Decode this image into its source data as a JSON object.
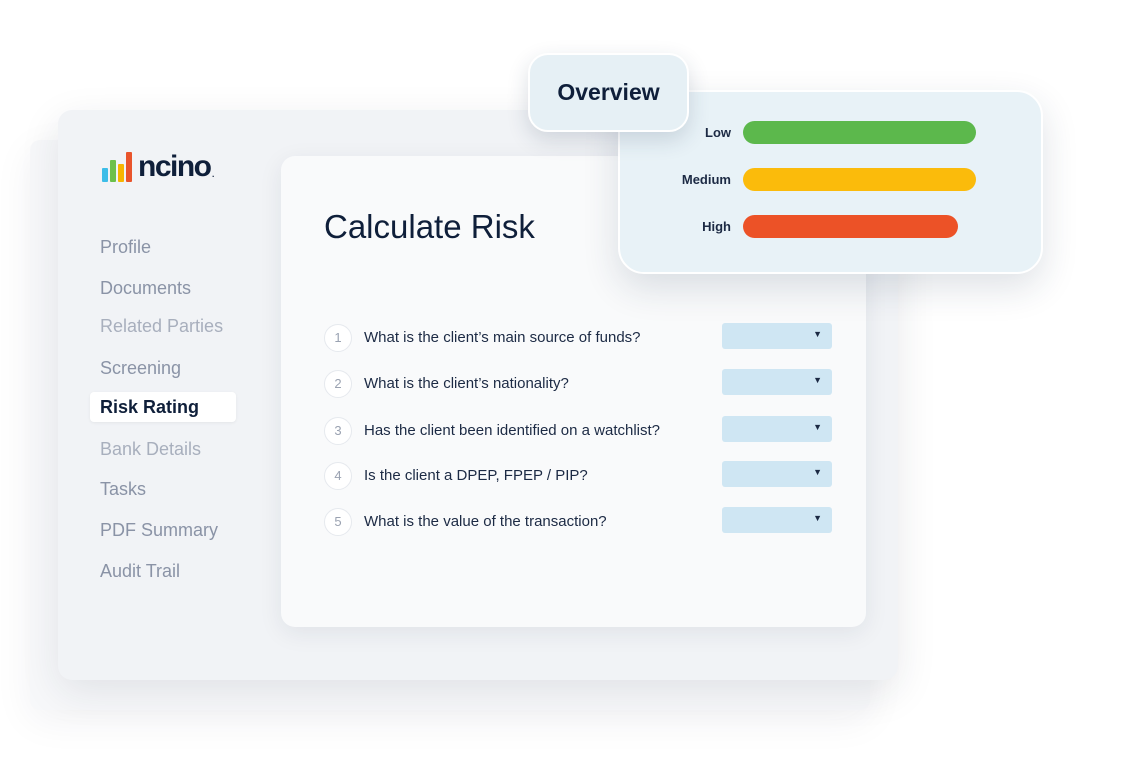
{
  "brand": {
    "name": "ncino",
    "trademark": ".",
    "bar_colors": [
      "#3dbde8",
      "#6cc04a",
      "#f7b500",
      "#e9542b"
    ]
  },
  "sidebar": {
    "items": [
      {
        "label": "Profile"
      },
      {
        "label": "Documents"
      },
      {
        "label": "Related Parties"
      },
      {
        "label": "Screening"
      },
      {
        "label": "Risk Rating",
        "active": true
      },
      {
        "label": "Bank Details"
      },
      {
        "label": "Tasks"
      },
      {
        "label": "PDF Summary"
      },
      {
        "label": "Audit Trail"
      }
    ]
  },
  "main": {
    "title": "Calculate Risk",
    "questions": [
      {
        "number": "1",
        "text": "What is the client’s main source of funds?"
      },
      {
        "number": "2",
        "text": "What is the client’s nationality?"
      },
      {
        "number": "3",
        "text": "Has the client been identified on a watchlist?"
      },
      {
        "number": "4",
        "text": "Is the client a DPEP, FPEP / PIP?"
      },
      {
        "number": "5",
        "text": "What is the value of the transaction?"
      }
    ],
    "select_caret": "▼"
  },
  "overview": {
    "title": "Overview",
    "levels": [
      {
        "label": "Low",
        "color": "#5cb84c"
      },
      {
        "label": "Medium",
        "color": "#fbbb0b"
      },
      {
        "label": "High",
        "color": "#ec5227"
      }
    ]
  }
}
